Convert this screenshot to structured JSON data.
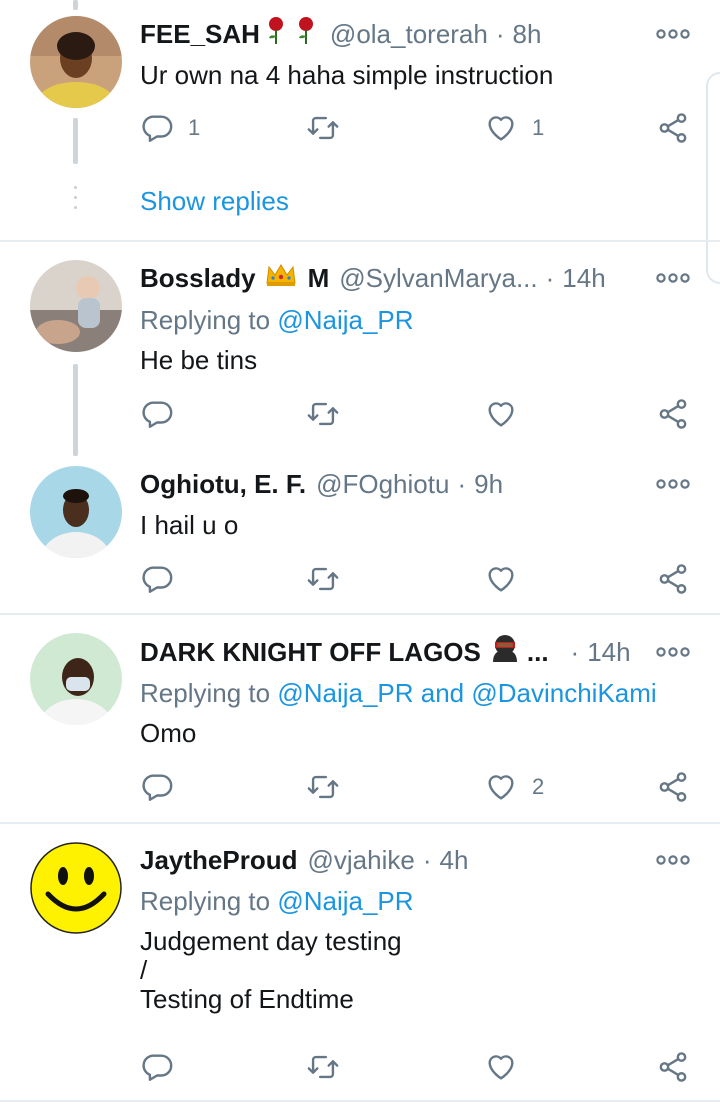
{
  "tweets": [
    {
      "name": "FEE_SAH",
      "handle": "@ola_torerah",
      "time": "8h",
      "text": "Ur own na 4 haha simple instruction",
      "reply_count": "1",
      "like_count": "1",
      "show_replies": "Show replies",
      "emoji": "rose-emoji"
    },
    {
      "name": "Bosslady",
      "name_suffix": "M",
      "handle": "@SylvanMarya...",
      "time": "14h",
      "replying_prefix": "Replying to",
      "replying_to": "@Naija_PR",
      "text": "He be tins",
      "emoji": "crown-emoji"
    },
    {
      "name": "Oghiotu, E. F.",
      "handle": "@FOghiotu",
      "time": "9h",
      "text": "I hail u o"
    },
    {
      "name": "DARK KNIGHT OFF LAGOS",
      "name_ellipsis": "...",
      "time": "14h",
      "replying_prefix": "Replying to",
      "replying_to": "@Naija_PR and @DavinchiKami",
      "text": "Omo",
      "like_count": "2",
      "emoji": "ninja-emoji"
    },
    {
      "name": "JaytheProud",
      "handle": "@vjahike",
      "time": "4h",
      "replying_prefix": "Replying to",
      "replying_to": "@Naija_PR",
      "text_lines": [
        "Judgement day testing",
        "/",
        "Testing of Endtime"
      ]
    }
  ],
  "separator": "·",
  "icons": {
    "reply": "reply-icon",
    "retweet": "retweet-icon",
    "like": "like-icon",
    "share": "share-icon",
    "more": "more-icon"
  },
  "colors": {
    "link": "#1b95e0",
    "secondary_text": "#657786",
    "icon": "#657786",
    "divider": "#e6ecf0"
  }
}
